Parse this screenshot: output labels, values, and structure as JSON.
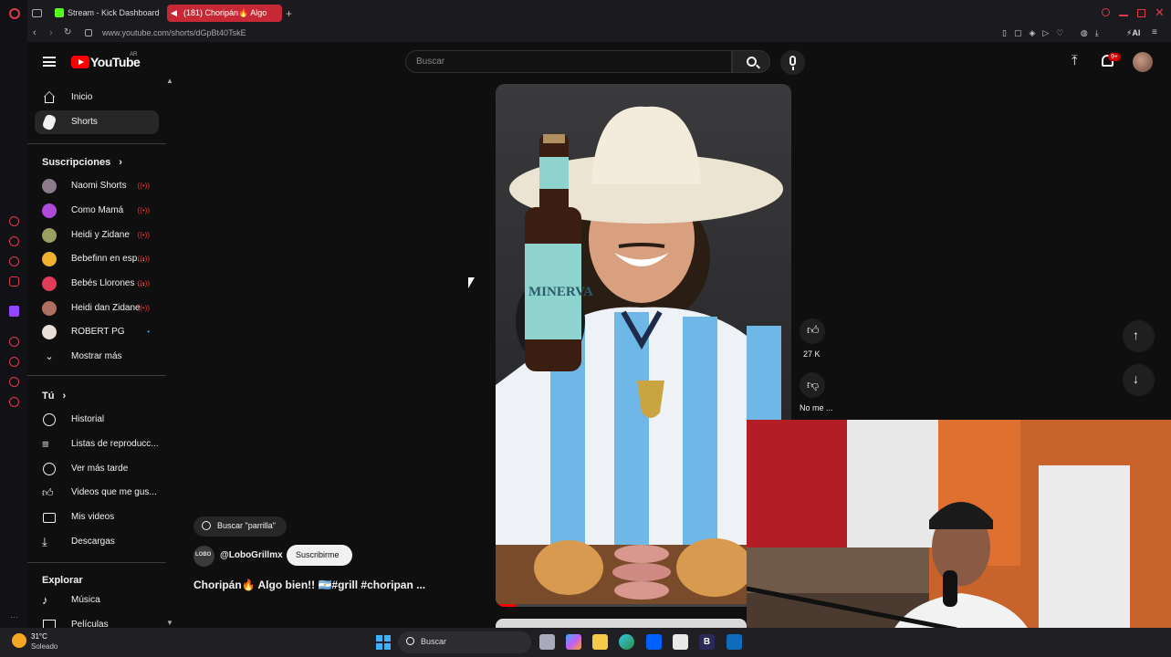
{
  "browser": {
    "tabs": [
      {
        "label": "Stream - Kick Dashboard"
      },
      {
        "label": "(181) Choripán🔥 Algo"
      }
    ],
    "url": "www.youtube.com/shorts/dGpBt40TskE"
  },
  "youtube": {
    "logo_text": "YouTube",
    "region": "AR",
    "search_placeholder": "Buscar",
    "notifications_badge": "9+",
    "nav": {
      "home": "Inicio",
      "shorts": "Shorts"
    },
    "subscriptions": {
      "title": "Suscripciones",
      "items": [
        {
          "name": "Naomi Shorts",
          "live": "((•))"
        },
        {
          "name": "Como Mamá",
          "live": "((•))"
        },
        {
          "name": "Heidi y Zidane",
          "live": "((•))"
        },
        {
          "name": "Bebefinn en esp...",
          "live": "((•))"
        },
        {
          "name": "Bebés Llorones ...",
          "live": "((•))"
        },
        {
          "name": "Heidi dan Zidane",
          "live": "((•))"
        },
        {
          "name": "ROBERT PG",
          "live": "•"
        }
      ],
      "show_more": "Mostrar más"
    },
    "you": {
      "title": "Tú",
      "items": [
        "Historial",
        "Listas de reproducc...",
        "Ver más tarde",
        "Videos que me gus...",
        "Mis videos",
        "Descargas"
      ]
    },
    "explore": {
      "title": "Explorar",
      "items": [
        "Música",
        "Películas"
      ]
    },
    "short": {
      "search_chip": "Buscar \"parrilla\"",
      "channel_avatar_text": "LOBO",
      "channel": "@LoboGrillmx",
      "subscribe": "Suscribirme",
      "title": "Choripán🔥 Algo bien!! 🇦🇷#grill #choripan ...",
      "likes": "27 K",
      "dislike_label": "No me ...",
      "bottle_text": "MINERVA"
    }
  },
  "taskbar": {
    "temperature": "31°C",
    "weather": "Soleado",
    "search": "Buscar"
  },
  "colors": {
    "background": "#0f0f0f",
    "accent_red": "#ff0000",
    "live_red": "#e53935",
    "active_tab": "#c62935"
  }
}
